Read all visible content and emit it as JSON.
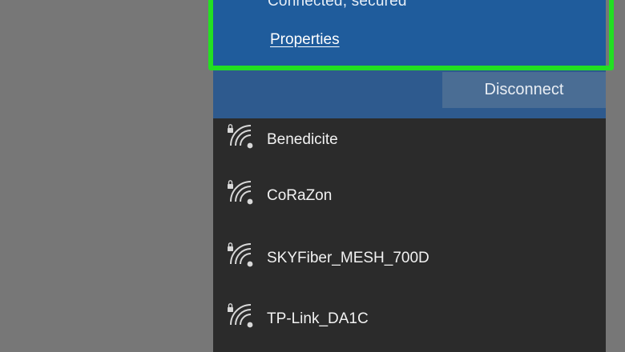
{
  "connected_network": {
    "status": "Connected, secured",
    "properties_label": "Properties",
    "disconnect_label": "Disconnect"
  },
  "networks": [
    {
      "name": "Benedicite",
      "icon": "wifi-secured-icon"
    },
    {
      "name": "CoRaZon",
      "icon": "wifi-secured-icon"
    },
    {
      "name": "SKYFiber_MESH_700D",
      "icon": "wifi-secured-icon"
    },
    {
      "name": "TP-Link_DA1C",
      "icon": "wifi-secured-icon"
    }
  ],
  "colors": {
    "background": "#777777",
    "flyout": "#2b2b2b",
    "connected_panel": "#2e5a8e",
    "connected_block": "#1f5c9c",
    "disconnect_button": "#4a6d94",
    "highlight": "#22e022"
  }
}
